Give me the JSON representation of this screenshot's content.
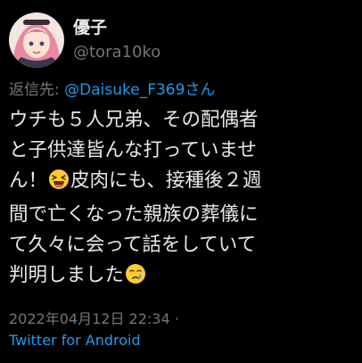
{
  "tweet": {
    "author": {
      "display_name": "優子",
      "handle": "@tora10ko"
    },
    "reply_to": {
      "label": "返信先:",
      "target": "@Daisuke_F369さん"
    },
    "body_lines": {
      "l1": "ウチも５人兄弟、その配偶者",
      "l2": "と子供達皆んな打っていませ",
      "l3a": "ん！",
      "l3b": "皮肉にも、接種後２週",
      "l4": "間で亡くなった親族の葬儀に",
      "l5": "て久々に会って話をしていて",
      "l6": "判明しました"
    },
    "emojis": {
      "first": "laughing-emoji",
      "second": "crying-emoji"
    },
    "timestamp": "2022年04月12日 22:34",
    "separator": "·",
    "source": "Twitter for Android"
  },
  "colors": {
    "background": "#000000",
    "text": "#e7e9ea",
    "secondary": "#71767b",
    "link": "#1d9bf0"
  }
}
